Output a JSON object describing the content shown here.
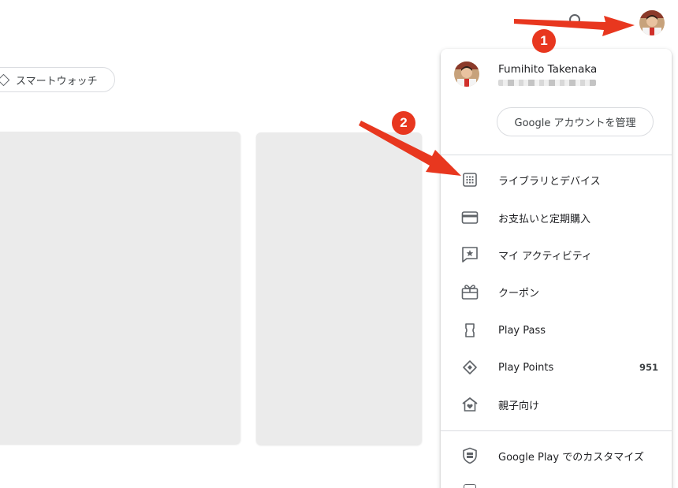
{
  "background": {
    "chip_label": "スマートウォッチ"
  },
  "account": {
    "name": "Fumihito Takenaka",
    "manage_label": "Google アカウントを管理"
  },
  "menu": {
    "items": [
      {
        "label": "ライブラリとデバイス",
        "icon": "library-grid-icon"
      },
      {
        "label": "お支払いと定期購入",
        "icon": "credit-card-icon"
      },
      {
        "label": "マイ アクティビティ",
        "icon": "activity-star-icon"
      },
      {
        "label": "クーポン",
        "icon": "gift-coupon-icon"
      },
      {
        "label": "Play Pass",
        "icon": "ticket-icon"
      },
      {
        "label": "Play Points",
        "icon": "diamond-points-icon",
        "count": "951"
      },
      {
        "label": "親子向け",
        "icon": "family-home-icon"
      }
    ],
    "bottom_items": [
      {
        "label": "Google Play でのカスタマイズ",
        "icon": "shield-personalize-icon"
      }
    ]
  },
  "annotations": {
    "step1": "1",
    "step2": "2",
    "arrow_color": "#e8371f"
  }
}
